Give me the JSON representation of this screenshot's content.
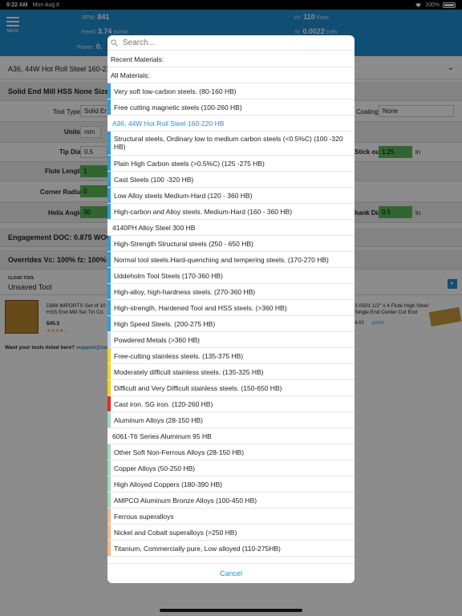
{
  "status": {
    "time": "9:22 AM",
    "date": "Mon Aug 8",
    "battery": "100%"
  },
  "header": {
    "menu_label": "MENU",
    "rpm_label": "RPM:",
    "rpm_value": "841",
    "feed_label": "Feed:",
    "feed_value": "3.74",
    "feed_unit": "in/min",
    "power_label": "Power:",
    "power_value": "0.",
    "vc_label": "Vc:",
    "vc_value": "110",
    "vc_unit": "f/min",
    "fz_label": "fz:",
    "fz_value": "0.0022",
    "fz_unit": "in/th"
  },
  "background": {
    "material": "A36, 44W Hot Roll Steel 160-22",
    "tool_title": "Solid End Mill HSS None Size:",
    "tool_type_label": "Tool Type",
    "tool_type_value": "Solid Er",
    "coating_label": "Coating",
    "coating_value": "None",
    "units_label": "Units",
    "units_value": "mm",
    "tip_dia_label": "Tip Dia",
    "tip_dia_value": "0.5",
    "stick_out_label": "Stick out",
    "stick_out_value": "1.25",
    "stick_out_unit": "in",
    "flute_length_label": "Flute Length",
    "flute_length_value": "1",
    "corner_radius_label": "Corner Radius",
    "corner_radius_value": "0",
    "helix_angle_label": "Helix Angle",
    "helix_angle_value": "30",
    "shank_dia_label": "hank Dia",
    "shank_dia_value": "0.5",
    "shank_dia_unit": "in",
    "engagement": "Engagement DOC: 0.875 WOC:",
    "overrides": "Overrides Vc: 100% fz: 100% M",
    "cloud_tool_label": "CLOUD TOOL",
    "cloud_tool_name": "Unsaved Tool",
    "ad1_title": "DBM IMPORTS Set of 10 HSS End Mill Set Tin Co",
    "ad1_price": "$45.5",
    "ad2_title": "2-0501 1/2\" x 4 Flute High Steel Single End Center Cut End",
    "ad2_price": "4.02",
    "prime": "prime",
    "listed_text": "Want your tools listed here?",
    "listed_link": "support@zero-"
  },
  "modal": {
    "search_placeholder": "Search...",
    "cancel_label": "Cancel",
    "items": [
      {
        "label": "Recent Materials:",
        "kind": "header",
        "color": ""
      },
      {
        "label": "All Materials:",
        "kind": "header",
        "color": ""
      },
      {
        "label": "Very soft low-carbon steels. (80-160 HB)",
        "kind": "item",
        "color": "#2f9ad8"
      },
      {
        "label": "Free cutting magnetic steels (100-260 HB)",
        "kind": "item",
        "color": "#2f9ad8"
      },
      {
        "label": "A36, 44W Hot Roll Steel 160-220 HB",
        "kind": "selected",
        "color": ""
      },
      {
        "label": "Structural steels, Ordinary low to medium carbon steels (<0.5%C) (100 -320 HB)",
        "kind": "two",
        "color": "#2f9ad8"
      },
      {
        "label": "Plain High Carbon steels (>0.5%C) (125 -275 HB)",
        "kind": "item",
        "color": "#2f9ad8"
      },
      {
        "label": "Cast Steels (100 -320 HB)",
        "kind": "item",
        "color": "#2f9ad8"
      },
      {
        "label": "Low Alloy steels Medium-Hard (120 - 360 HB)",
        "kind": "item",
        "color": "#2f9ad8"
      },
      {
        "label": "High-carbon and Alloy steels. Medium-Hard (160 - 360 HB)",
        "kind": "item",
        "color": "#2f9ad8"
      },
      {
        "label": "4140PH Alloy Steel 300 HB",
        "kind": "plain",
        "color": ""
      },
      {
        "label": "High-Strength Structural steels (250 - 650 HB)",
        "kind": "item",
        "color": "#2f9ad8"
      },
      {
        "label": "Normal tool steels.Hard-quenching and tempering steels. (170-270 HB)",
        "kind": "item",
        "color": "#2f9ad8"
      },
      {
        "label": "Uddeholm Tool Steels (170-360 HB)",
        "kind": "item",
        "color": "#2f9ad8"
      },
      {
        "label": "High-alloy, high-hardness steels. (270-360 HB)",
        "kind": "item",
        "color": "#2f9ad8"
      },
      {
        "label": "High-strength, Hardened Tool and HSS steels. (>360 HB)",
        "kind": "item",
        "color": "#2f9ad8"
      },
      {
        "label": "High Speed Steels. (200-275 HB)",
        "kind": "item",
        "color": "#2f9ad8"
      },
      {
        "label": "Powdered Metals (>360 HB)",
        "kind": "item",
        "color": "#b9d4e8"
      },
      {
        "label": "Free-cutting stainless steels. (135-375 HB)",
        "kind": "item",
        "color": "#f2d410"
      },
      {
        "label": "Moderately difficult stainless steels. (135-325 HB)",
        "kind": "item",
        "color": "#f2d410"
      },
      {
        "label": "Difficult and Very Difficult stainless steels. (150-650 HB)",
        "kind": "item",
        "color": "#f2d410"
      },
      {
        "label": "Cast iron. SG iron. (120-260 HB)",
        "kind": "item",
        "color": "#e02a2a"
      },
      {
        "label": "Aluminum Alloys (28-150 HB)",
        "kind": "item",
        "color": "#9fd9c0"
      },
      {
        "label": "6061-T6 Series Aluminum 95 HB",
        "kind": "plain",
        "color": ""
      },
      {
        "label": "Other Soft Non-Ferrous Alloys (28-150 HB)",
        "kind": "item",
        "color": "#9fd9c0"
      },
      {
        "label": "Copper Alloys (50-250 HB)",
        "kind": "item",
        "color": "#9fd9c0"
      },
      {
        "label": "High Alloyed Coppers (180-390 HB)",
        "kind": "item",
        "color": "#9fd9c0"
      },
      {
        "label": "AMPCO Aluminum Bronze Alloys (100-450 HB)",
        "kind": "item",
        "color": "#9fd9c0"
      },
      {
        "label": "Ferrous superalloys",
        "kind": "item",
        "color": "#f5b88a"
      },
      {
        "label": "Nickel and Cobalt superalloys (>250 HB)",
        "kind": "item",
        "color": "#f5b88a"
      },
      {
        "label": "Titanium, Commercially pure, Low alloyed (110-275HB)",
        "kind": "item",
        "color": "#f5b88a"
      }
    ]
  }
}
